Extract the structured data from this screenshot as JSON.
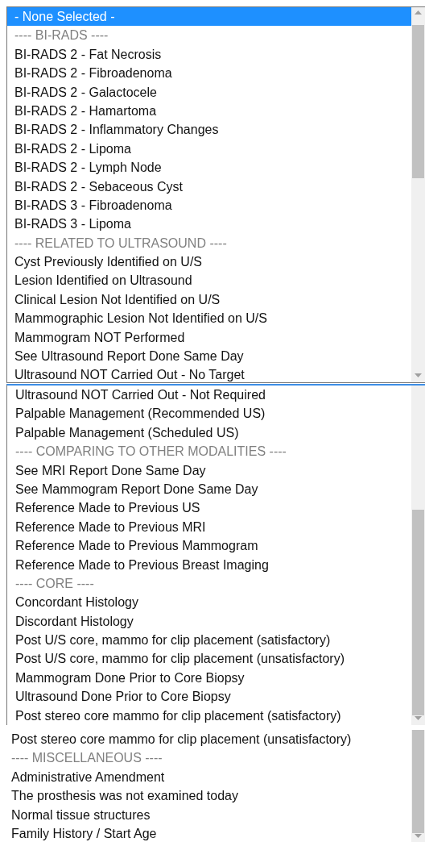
{
  "lists": [
    {
      "focused": false,
      "options": [
        {
          "kind": "option",
          "label": "- None Selected -",
          "selected": true
        },
        {
          "kind": "header",
          "label": "---- BI-RADS ----",
          "selected": false
        },
        {
          "kind": "option",
          "label": "BI-RADS 2 - Fat Necrosis",
          "selected": false
        },
        {
          "kind": "option",
          "label": "BI-RADS 2 - Fibroadenoma",
          "selected": false
        },
        {
          "kind": "option",
          "label": "BI-RADS 2 - Galactocele",
          "selected": false
        },
        {
          "kind": "option",
          "label": "BI-RADS 2 - Hamartoma",
          "selected": false
        },
        {
          "kind": "option",
          "label": "BI-RADS 2 - Inflammatory Changes",
          "selected": false
        },
        {
          "kind": "option",
          "label": "BI-RADS 2 - Lipoma",
          "selected": false
        },
        {
          "kind": "option",
          "label": "BI-RADS 2 - Lymph Node",
          "selected": false
        },
        {
          "kind": "option",
          "label": "BI-RADS 2 - Sebaceous Cyst",
          "selected": false
        },
        {
          "kind": "option",
          "label": "BI-RADS 3 - Fibroadenoma",
          "selected": false
        },
        {
          "kind": "option",
          "label": "BI-RADS 3 - Lipoma",
          "selected": false
        },
        {
          "kind": "header",
          "label": "---- RELATED TO ULTRASOUND ----",
          "selected": false
        },
        {
          "kind": "option",
          "label": "Cyst Previously Identified on U/S",
          "selected": false
        },
        {
          "kind": "option",
          "label": "Lesion Identified on Ultrasound",
          "selected": false
        },
        {
          "kind": "option",
          "label": "Clinical Lesion Not Identified on U/S",
          "selected": false
        },
        {
          "kind": "option",
          "label": "Mammographic Lesion Not Identified on U/S",
          "selected": false
        },
        {
          "kind": "option",
          "label": "Mammogram NOT Performed",
          "selected": false
        },
        {
          "kind": "option",
          "label": "See Ultrasound Report Done Same Day",
          "selected": false
        },
        {
          "kind": "option",
          "label": "Ultrasound NOT Carried Out - No Target",
          "selected": false
        }
      ]
    },
    {
      "focused": true,
      "options": [
        {
          "kind": "option",
          "label": "Ultrasound NOT Carried Out - Not Required",
          "selected": false
        },
        {
          "kind": "option",
          "label": "Palpable Management (Recommended US)",
          "selected": false
        },
        {
          "kind": "option",
          "label": "Palpable Management (Scheduled US)",
          "selected": false
        },
        {
          "kind": "header",
          "label": "---- COMPARING TO OTHER MODALITIES ----",
          "selected": false
        },
        {
          "kind": "option",
          "label": "See MRI Report Done Same Day",
          "selected": false
        },
        {
          "kind": "option",
          "label": "See Mammogram Report Done Same Day",
          "selected": false
        },
        {
          "kind": "option",
          "label": "Reference Made to Previous US",
          "selected": false
        },
        {
          "kind": "option",
          "label": "Reference Made to Previous MRI",
          "selected": false
        },
        {
          "kind": "option",
          "label": "Reference Made to Previous Mammogram",
          "selected": false
        },
        {
          "kind": "option",
          "label": "Reference Made to Previous Breast Imaging",
          "selected": false
        },
        {
          "kind": "header",
          "label": "---- CORE ----",
          "selected": false
        },
        {
          "kind": "option",
          "label": "Concordant Histology",
          "selected": false
        },
        {
          "kind": "option",
          "label": "Discordant Histology",
          "selected": false
        },
        {
          "kind": "option",
          "label": "Post U/S core, mammo for clip placement (satisfactory)",
          "selected": false
        },
        {
          "kind": "option",
          "label": "Post U/S core, mammo for clip placement (unsatisfactory)",
          "selected": false
        },
        {
          "kind": "option",
          "label": "Mammogram Done Prior to Core Biopsy",
          "selected": false
        },
        {
          "kind": "option",
          "label": "Ultrasound Done Prior to Core Biopsy",
          "selected": false
        },
        {
          "kind": "option",
          "label": "Post stereo core mammo for clip placement (satisfactory)",
          "selected": false
        }
      ]
    },
    {
      "focused": false,
      "options": [
        {
          "kind": "option",
          "label": "Post stereo core mammo for clip placement (unsatisfactory)",
          "selected": false
        },
        {
          "kind": "header",
          "label": "---- MISCELLANEOUS ----",
          "selected": false
        },
        {
          "kind": "option",
          "label": "Administrative Amendment",
          "selected": false
        },
        {
          "kind": "option",
          "label": "The prosthesis was not examined today",
          "selected": false
        },
        {
          "kind": "option",
          "label": "Normal tissue structures",
          "selected": false
        },
        {
          "kind": "option",
          "label": "Family History / Start Age",
          "selected": false
        }
      ]
    }
  ]
}
